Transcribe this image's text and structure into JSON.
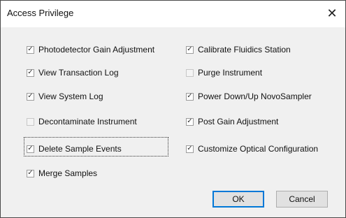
{
  "dialog": {
    "title": "Access Privilege",
    "close_glyph": "✕"
  },
  "left_column": [
    {
      "label": "Photodetector Gain Adjustment",
      "checked": true
    },
    {
      "label": "View Transaction Log",
      "checked": true
    },
    {
      "label": "View System Log",
      "checked": true
    },
    {
      "label": "Decontaminate Instrument",
      "checked": false
    },
    {
      "label": "Delete Sample Events",
      "checked": true
    },
    {
      "label": "Merge Samples",
      "checked": true
    }
  ],
  "right_column": [
    {
      "label": "Calibrate Fluidics Station",
      "checked": true
    },
    {
      "label": "Purge Instrument",
      "checked": false
    },
    {
      "label": "Power Down/Up NovoSampler",
      "checked": true
    },
    {
      "label": "Post Gain Adjustment",
      "checked": true
    },
    {
      "label": "Customize Optical Configuration",
      "checked": true
    }
  ],
  "buttons": {
    "ok_label": "OK",
    "cancel_label": "Cancel"
  },
  "check_glyph": "✓",
  "colors": {
    "default_button_border": "#0078d7",
    "dialog_background": "#f0f0f0"
  }
}
